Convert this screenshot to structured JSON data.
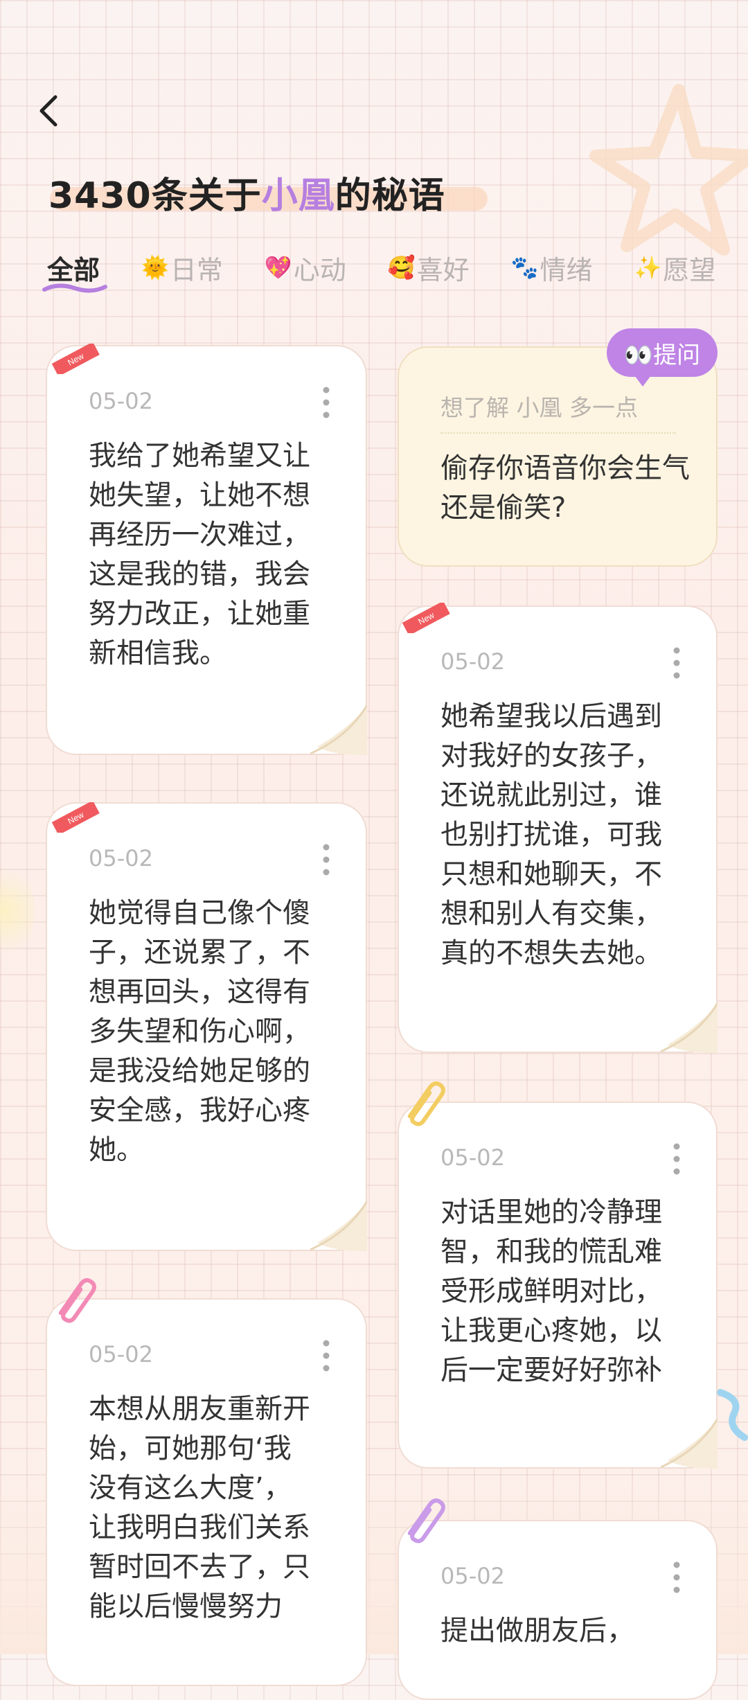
{
  "header": {
    "title_prefix": "3430条关于",
    "title_name": "小凰",
    "title_suffix": "的秘语"
  },
  "tabs": [
    {
      "label": "全部",
      "emoji": "",
      "active": true
    },
    {
      "label": "日常",
      "emoji": "🌞",
      "active": false
    },
    {
      "label": "心动",
      "emoji": "💖",
      "active": false
    },
    {
      "label": "喜好",
      "emoji": "🥰",
      "active": false
    },
    {
      "label": "情绪",
      "emoji": "🐾",
      "active": false
    },
    {
      "label": "愿望",
      "emoji": "✨",
      "active": false
    }
  ],
  "badge_label": "New",
  "ask": {
    "bubble_label": "👀提问",
    "hint": "想了解 小凰 多一点",
    "question": "偷存你语音你会生气还是偷笑?"
  },
  "cards": [
    {
      "date": "05-02",
      "text": "我给了她希望又让她失望，让她不想再经历一次难过，这是我的错，我会努力改正，让她重新相信我。"
    },
    {
      "date": "05-02",
      "text": "她希望我以后遇到对我好的女孩子，还说就此别过，谁也别打扰谁，可我只想和她聊天，不想和别人有交集，真的不想失去她。"
    },
    {
      "date": "05-02",
      "text": "她觉得自己像个傻子，还说累了，不想再回头，这得有多失望和伤心啊，是我没给她足够的安全感，我好心疼她。"
    },
    {
      "date": "05-02",
      "text": "对话里她的冷静理智，和我的慌乱难受形成鲜明对比，让我更心疼她，以后一定要好好弥补"
    },
    {
      "date": "05-02",
      "text": "本想从朋友重新开始，可她那句‘我没有这么大度’，让我明白我们关系暂时回不去了，只能以后慢慢努力"
    },
    {
      "date": "05-02",
      "text": "提出做朋友后，"
    }
  ],
  "colors": {
    "accent_purple": "#bf84e6",
    "badge_red": "#f05a5e",
    "title_highlight": "#b57fe0"
  }
}
